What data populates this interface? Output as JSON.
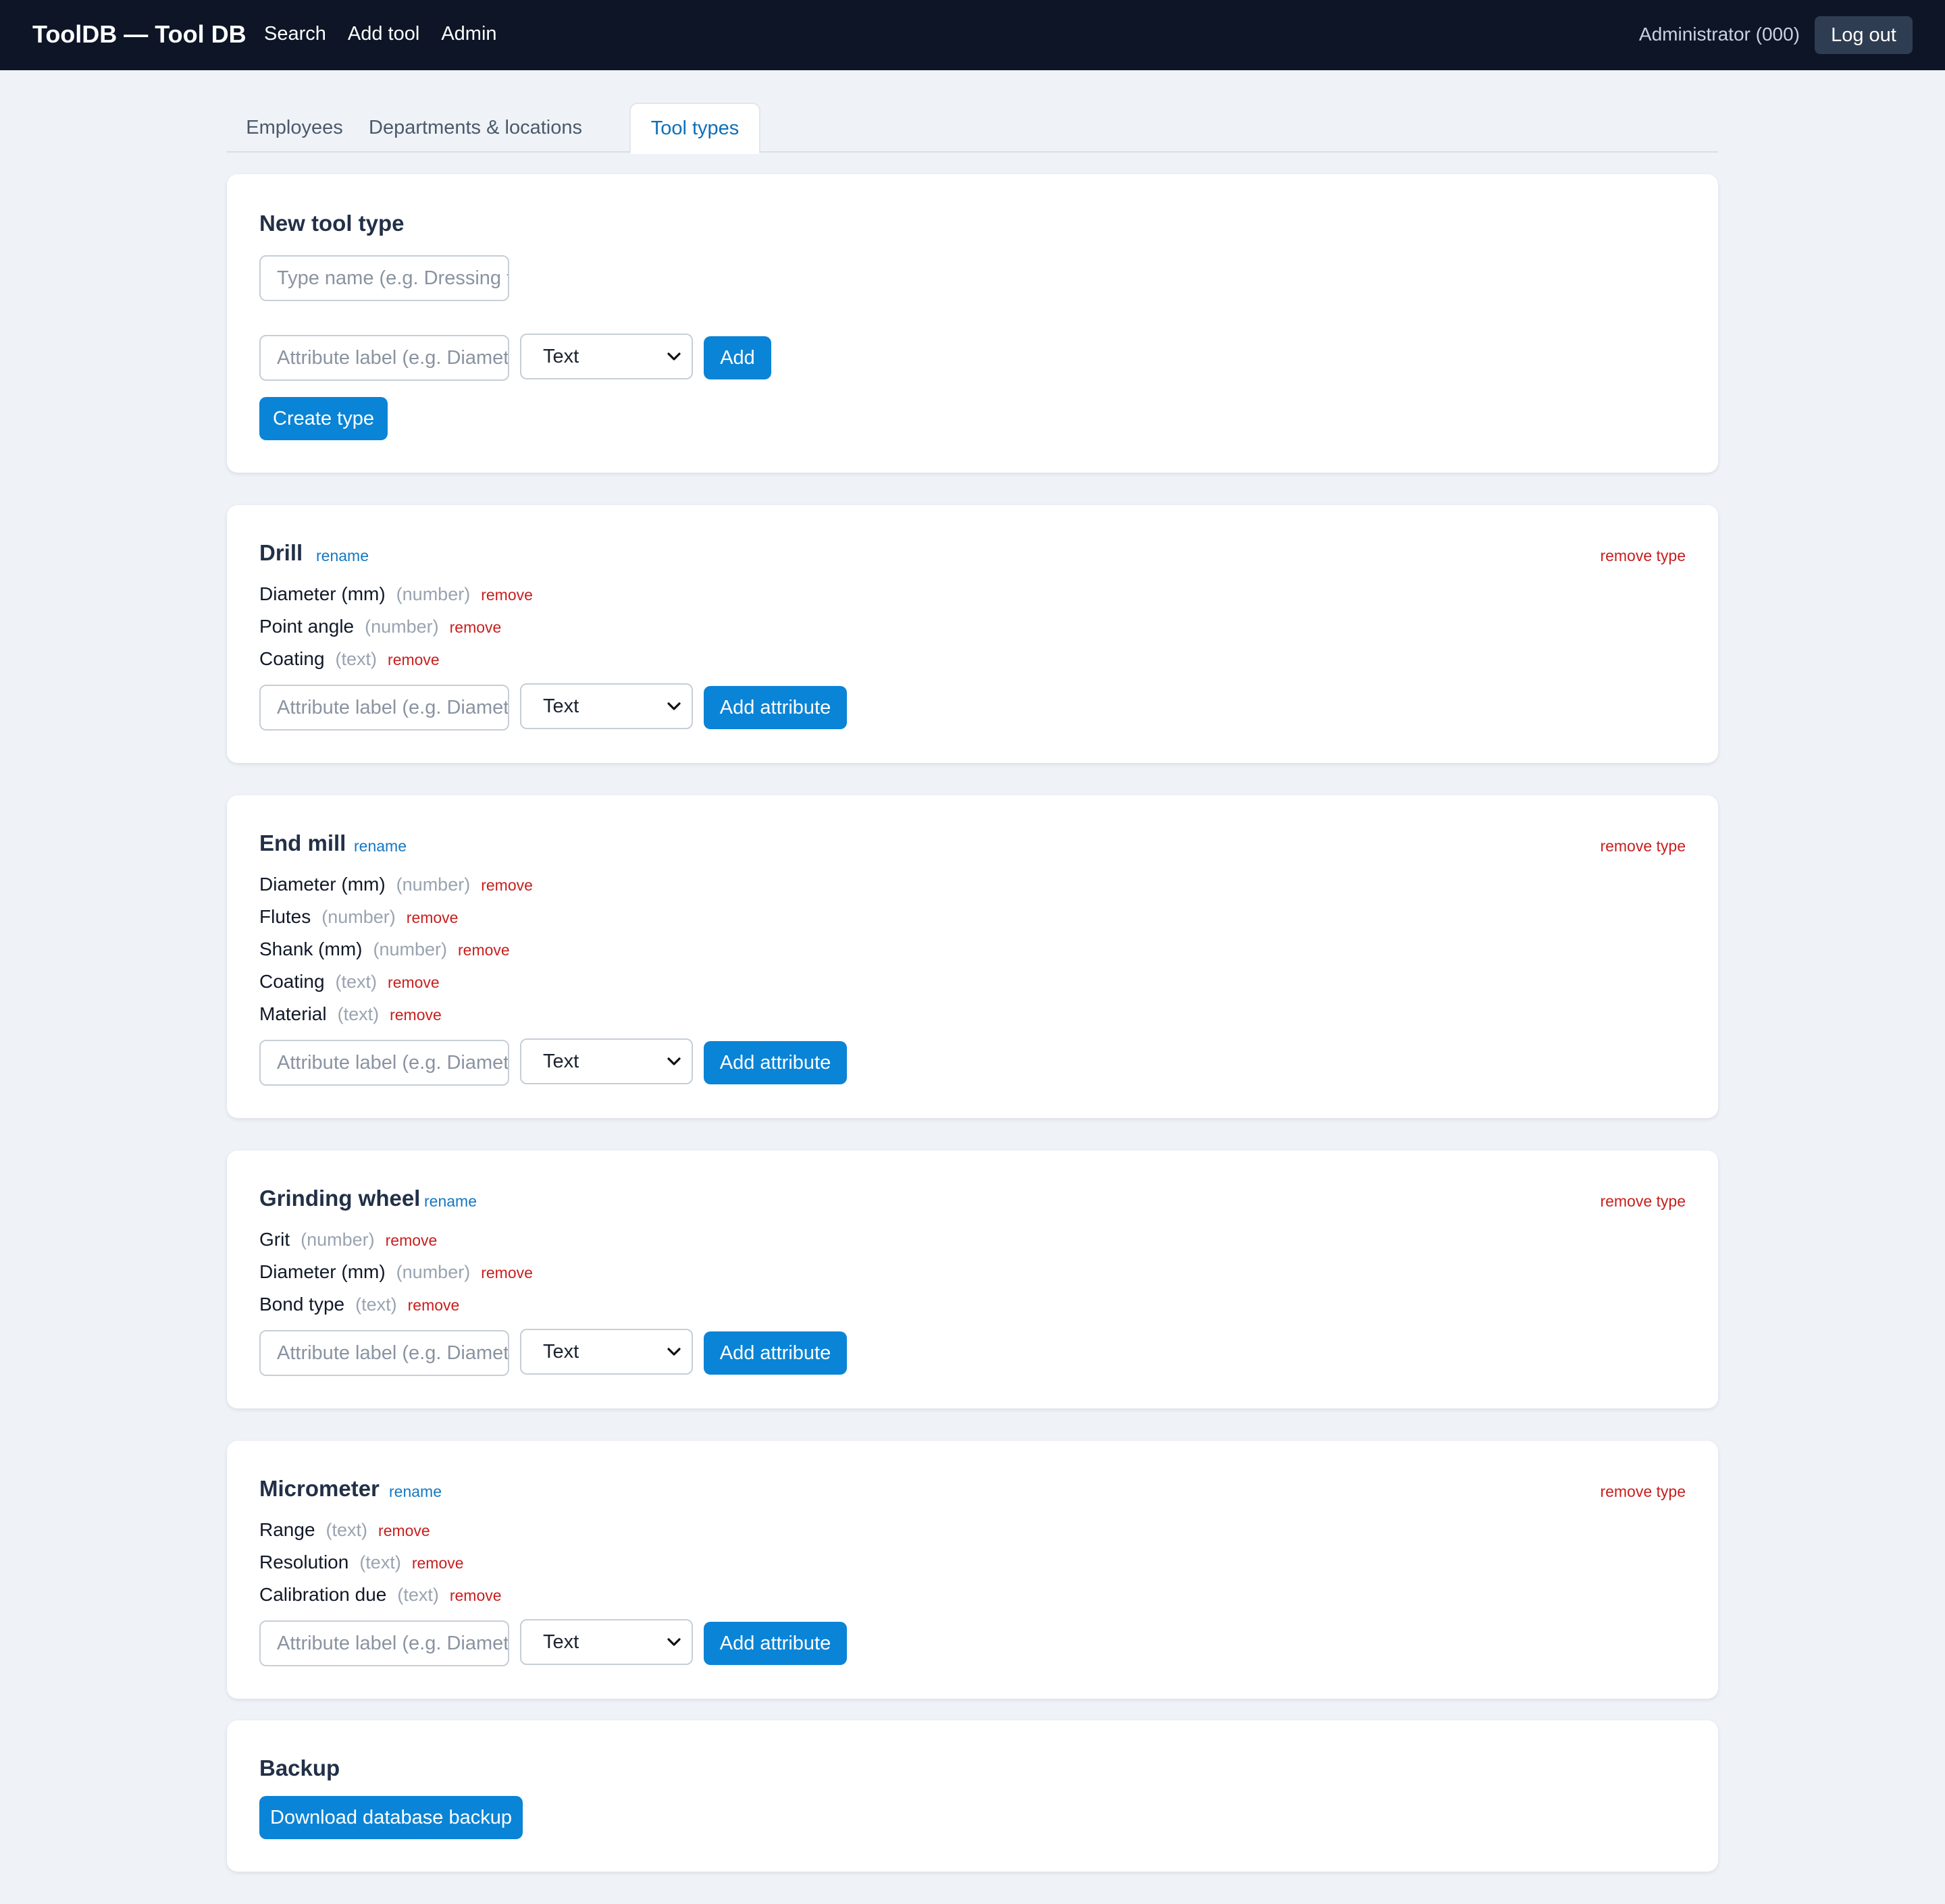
{
  "header": {
    "brand": "ToolDB — Tool DB",
    "nav": [
      "Search",
      "Add tool",
      "Admin"
    ],
    "user": "Administrator (000)",
    "logout": "Log out"
  },
  "tabs": [
    "Employees",
    "Departments & locations",
    "Tool types"
  ],
  "active_tab": "Tool types",
  "new_type": {
    "title": "New tool type",
    "name_placeholder": "Type name (e.g. Dressing tool)",
    "attr_placeholder": "Attribute label (e.g. Diameter)",
    "select_value": "Text",
    "add_label": "Add",
    "create_label": "Create type"
  },
  "types": [
    {
      "name": "Drill",
      "rename": "rename",
      "remove_type": "remove type",
      "attrs": [
        {
          "label": "Diameter (mm)",
          "kind": "(number)",
          "remove": "remove"
        },
        {
          "label": "Point angle",
          "kind": "(number)",
          "remove": "remove"
        },
        {
          "label": "Coating",
          "kind": "(text)",
          "remove": "remove"
        }
      ],
      "attr_placeholder": "Attribute label (e.g. Diameter)",
      "select_value": "Text",
      "add_label": "Add attribute"
    },
    {
      "name": "End mill",
      "rename": "rename",
      "remove_type": "remove type",
      "attrs": [
        {
          "label": "Diameter (mm)",
          "kind": "(number)",
          "remove": "remove"
        },
        {
          "label": "Flutes",
          "kind": "(number)",
          "remove": "remove"
        },
        {
          "label": "Shank (mm)",
          "kind": "(number)",
          "remove": "remove"
        },
        {
          "label": "Coating",
          "kind": "(text)",
          "remove": "remove"
        },
        {
          "label": "Material",
          "kind": "(text)",
          "remove": "remove"
        }
      ],
      "attr_placeholder": "Attribute label (e.g. Diameter)",
      "select_value": "Text",
      "add_label": "Add attribute"
    },
    {
      "name": "Grinding wheel",
      "rename": "rename",
      "remove_type": "remove type",
      "attrs": [
        {
          "label": "Grit",
          "kind": "(number)",
          "remove": "remove"
        },
        {
          "label": "Diameter (mm)",
          "kind": "(number)",
          "remove": "remove"
        },
        {
          "label": "Bond type",
          "kind": "(text)",
          "remove": "remove"
        }
      ],
      "attr_placeholder": "Attribute label (e.g. Diameter)",
      "select_value": "Text",
      "add_label": "Add attribute"
    },
    {
      "name": "Micrometer",
      "rename": "rename",
      "remove_type": "remove type",
      "attrs": [
        {
          "label": "Range",
          "kind": "(text)",
          "remove": "remove"
        },
        {
          "label": "Resolution",
          "kind": "(text)",
          "remove": "remove"
        },
        {
          "label": "Calibration due",
          "kind": "(text)",
          "remove": "remove"
        }
      ],
      "attr_placeholder": "Attribute label (e.g. Diameter)",
      "select_value": "Text",
      "add_label": "Add attribute"
    }
  ],
  "backup": {
    "title": "Backup",
    "button": "Download database backup"
  }
}
